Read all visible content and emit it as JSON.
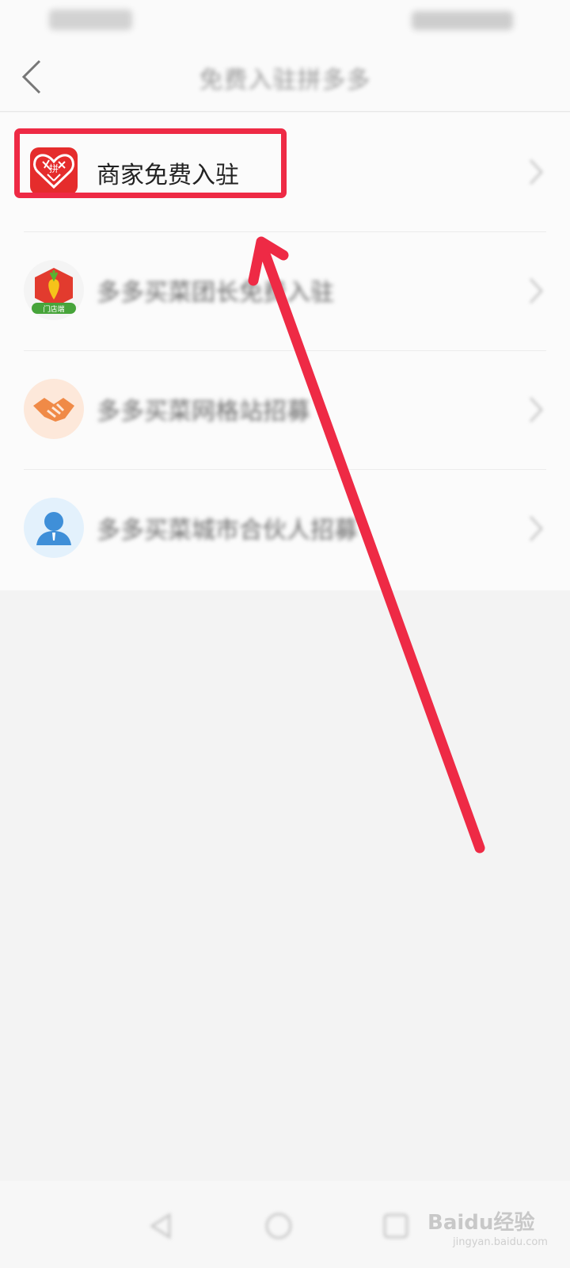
{
  "nav": {
    "title": "免费入驻拼多多"
  },
  "list": {
    "highlighted_item": {
      "label": "商家免费入驻",
      "icon": "pinduoduo-logo-icon"
    },
    "items": [
      {
        "label": "多多买菜团长免费入驻",
        "icon": "carrot-store-icon"
      },
      {
        "label": "多多买菜网格站招募",
        "icon": "handshake-icon"
      },
      {
        "label": "多多买菜城市合伙人招募",
        "icon": "person-icon"
      }
    ]
  },
  "pdd_icon_text": "拼",
  "store_badge": "门店端",
  "watermark": {
    "brand": "Baidu经验",
    "url": "jingyan.baidu.com"
  },
  "colors": {
    "highlight": "#ee2a45",
    "brand": "#e52c2c"
  }
}
